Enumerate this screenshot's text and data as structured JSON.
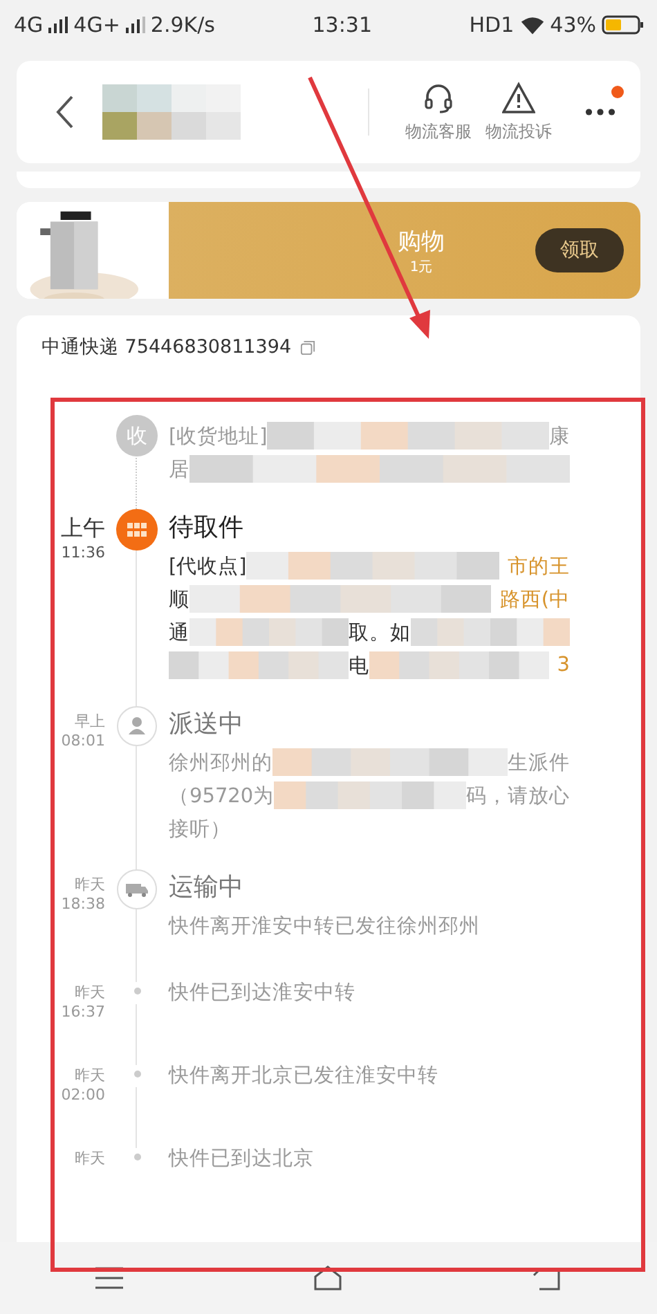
{
  "status_bar": {
    "network_1": "4G",
    "network_2": "4G+",
    "speed": "2.9K/s",
    "time": "13:31",
    "hd": "HD1",
    "battery": "43%"
  },
  "header": {
    "actions": [
      {
        "kind": "headset",
        "label": "物流客服"
      },
      {
        "kind": "warning",
        "label": "物流投诉"
      }
    ],
    "more_badge": true
  },
  "banner": {
    "title": "购物",
    "subtitle": "1元",
    "button": "领取"
  },
  "tracking": {
    "carrier": "中通快递",
    "number": "75446830811394"
  },
  "events": [
    {
      "kind": "char",
      "icon_text": "收",
      "current": false,
      "lines": [
        [
          {
            "kind": "text",
            "text": "[收货地址]"
          },
          {
            "kind": "redacted"
          },
          {
            "kind": "text",
            "text": "康"
          }
        ],
        [
          {
            "kind": "text",
            "text": "居"
          },
          {
            "kind": "redacted"
          }
        ]
      ]
    },
    {
      "kind": "grid",
      "current": true,
      "day": "上午",
      "time": "11:36",
      "title": "待取件",
      "lines": [
        [
          {
            "kind": "text",
            "text": "[代收点]"
          },
          {
            "kind": "redacted"
          },
          {
            "kind": "text",
            "text": "市的王"
          }
        ],
        [
          {
            "kind": "text",
            "text": "顺"
          },
          {
            "kind": "redacted"
          },
          {
            "kind": "text",
            "text": "路西(中"
          }
        ],
        [
          {
            "kind": "text",
            "text": "通"
          },
          {
            "kind": "redacted"
          },
          {
            "kind": "text",
            "text": "取。如"
          },
          {
            "kind": "redacted"
          }
        ],
        [
          {
            "kind": "redacted"
          },
          {
            "kind": "text",
            "text": "电"
          },
          {
            "kind": "redacted"
          },
          {
            "kind": "text",
            "text": "3"
          }
        ]
      ]
    },
    {
      "kind": "person",
      "current": false,
      "day": "早上",
      "time": "08:01",
      "title": "派送中",
      "lines": [
        [
          {
            "kind": "text",
            "text": "徐州邳州的"
          },
          {
            "kind": "redacted"
          },
          {
            "kind": "text",
            "text": "生派件"
          }
        ],
        [
          {
            "kind": "text",
            "text": "（95720为"
          },
          {
            "kind": "redacted"
          },
          {
            "kind": "text",
            "text": "码，请放心"
          }
        ],
        [
          {
            "kind": "text",
            "text": "接听）"
          }
        ]
      ]
    },
    {
      "kind": "truck",
      "current": false,
      "day": "昨天",
      "time": "18:38",
      "title": "运输中",
      "lines": [
        [
          {
            "kind": "text",
            "text": "快件离开淮安中转已发往徐州邳州"
          }
        ]
      ]
    },
    {
      "kind": "dot",
      "current": false,
      "day": "昨天",
      "time": "16:37",
      "lines": [
        [
          {
            "kind": "text",
            "text": "快件已到达淮安中转"
          }
        ]
      ]
    },
    {
      "kind": "dot",
      "current": false,
      "day": "昨天",
      "time": "02:00",
      "lines": [
        [
          {
            "kind": "text",
            "text": "快件离开北京已发往淮安中转"
          }
        ]
      ]
    },
    {
      "kind": "dot",
      "current": false,
      "day": "昨天",
      "lines": [
        [
          {
            "kind": "text",
            "text": "快件已到达北京"
          }
        ]
      ]
    }
  ]
}
